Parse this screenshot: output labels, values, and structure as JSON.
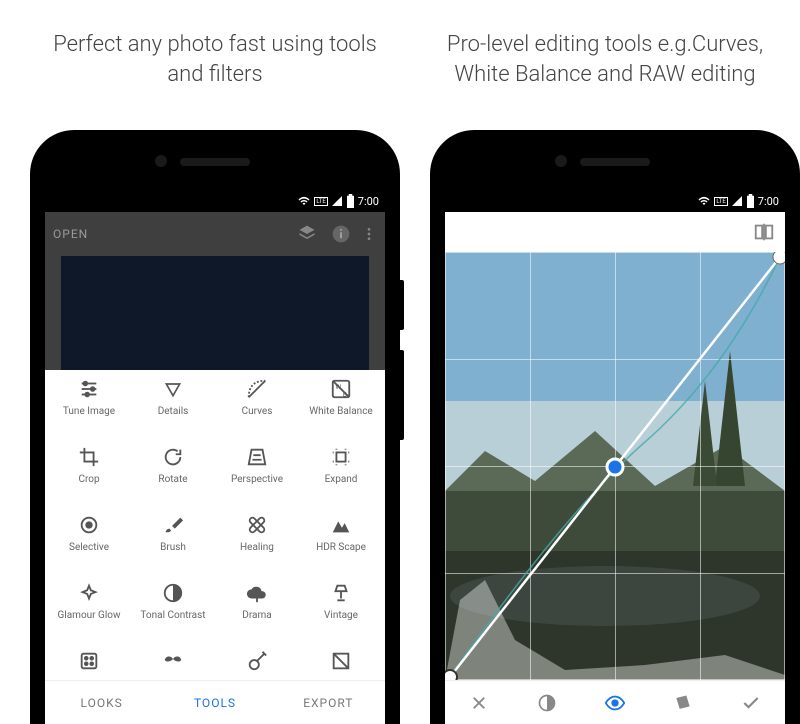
{
  "captions": {
    "left": "Perfect any photo fast using tools and filters",
    "right": "Pro-level editing tools e.g.Curves, White Balance and RAW editing"
  },
  "status": {
    "time": "7:00",
    "network": "LTE"
  },
  "left_phone": {
    "open_label": "OPEN",
    "tabs": {
      "looks": "LOOKS",
      "tools": "TOOLS",
      "export": "EXPORT",
      "active": "tools"
    },
    "tools": [
      {
        "label": "Tune Image",
        "icon": "sliders"
      },
      {
        "label": "Details",
        "icon": "triangle-down"
      },
      {
        "label": "Curves",
        "icon": "curve"
      },
      {
        "label": "White Balance",
        "icon": "wb"
      },
      {
        "label": "Crop",
        "icon": "crop"
      },
      {
        "label": "Rotate",
        "icon": "rotate"
      },
      {
        "label": "Perspective",
        "icon": "perspective"
      },
      {
        "label": "Expand",
        "icon": "expand"
      },
      {
        "label": "Selective",
        "icon": "target"
      },
      {
        "label": "Brush",
        "icon": "brush"
      },
      {
        "label": "Healing",
        "icon": "bandaid"
      },
      {
        "label": "HDR Scape",
        "icon": "mountains"
      },
      {
        "label": "Glamour Glow",
        "icon": "sparkle"
      },
      {
        "label": "Tonal Contrast",
        "icon": "halfcircle"
      },
      {
        "label": "Drama",
        "icon": "cloud"
      },
      {
        "label": "Vintage",
        "icon": "lamp"
      },
      {
        "label": "",
        "icon": "dice"
      },
      {
        "label": "",
        "icon": "mustache"
      },
      {
        "label": "",
        "icon": "guitar"
      },
      {
        "label": "",
        "icon": "square-a"
      }
    ]
  },
  "right_phone": {
    "curves": {
      "channel_active": "luminance",
      "control_points": [
        {
          "x": 0.0,
          "y": 0.0
        },
        {
          "x": 0.5,
          "y": 0.5
        },
        {
          "x": 1.0,
          "y": 1.0
        }
      ]
    },
    "bottom_icons": [
      "close",
      "contrast",
      "eye",
      "card",
      "check"
    ]
  }
}
